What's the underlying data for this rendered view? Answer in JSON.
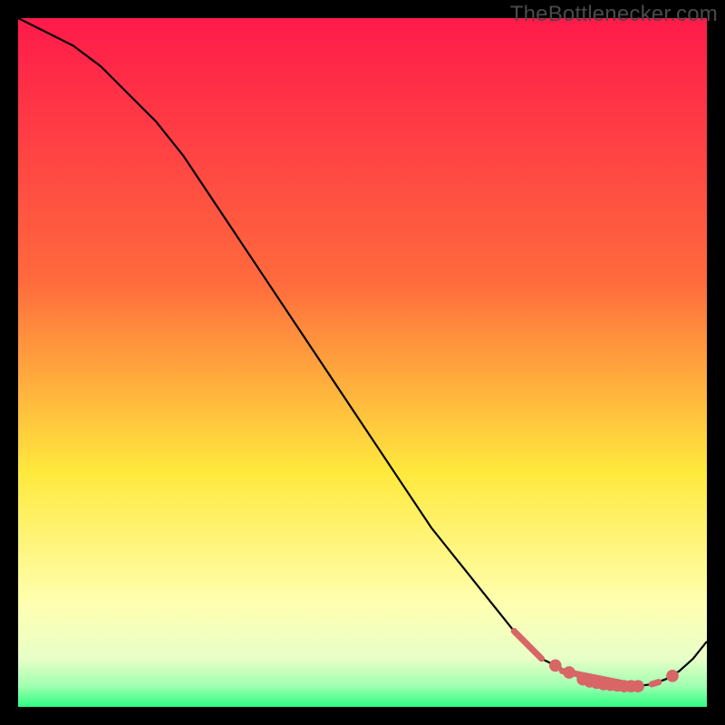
{
  "watermark": "TheBottlenecker.com",
  "colors": {
    "gradient_top": "#ff1a4a",
    "gradient_mid_orange": "#ff9e3d",
    "gradient_yellow": "#ffe93d",
    "gradient_pale_yellow": "#ffffb0",
    "gradient_mint": "#9fffb0",
    "gradient_green": "#2dff82",
    "curve_stroke": "#000000",
    "segment_color": "#d86666",
    "dot_color": "#d86666",
    "frame_bg": "#000000"
  },
  "chart_data": {
    "type": "line",
    "title": "",
    "xlabel": "",
    "ylabel": "",
    "xlim": [
      0,
      100
    ],
    "ylim": [
      0,
      100
    ],
    "curve": {
      "x": [
        0,
        4,
        8,
        12,
        16,
        20,
        24,
        28,
        32,
        36,
        40,
        44,
        48,
        52,
        56,
        60,
        64,
        68,
        72,
        76,
        78,
        80,
        82,
        84,
        86,
        88,
        90,
        92,
        94,
        96,
        98,
        100
      ],
      "y": [
        100,
        98,
        96,
        93,
        89,
        85,
        80,
        74,
        68,
        62,
        56,
        50,
        44,
        38,
        32,
        26,
        21,
        16,
        11,
        7,
        6,
        5,
        4,
        3.5,
        3.2,
        3.0,
        3.0,
        3.3,
        4.0,
        5.2,
        7.0,
        9.5
      ]
    },
    "highlight_segments": [
      {
        "x0": 72,
        "y0": 11,
        "x1": 76,
        "y1": 7
      },
      {
        "x0": 79,
        "y0": 5.2,
        "x1": 90,
        "y1": 3.0
      },
      {
        "x0": 92,
        "y0": 3.3,
        "x1": 93,
        "y1": 3.6
      }
    ],
    "dots": [
      {
        "x": 78,
        "y": 6
      },
      {
        "x": 80,
        "y": 5
      },
      {
        "x": 82,
        "y": 4
      },
      {
        "x": 83,
        "y": 3.7
      },
      {
        "x": 84,
        "y": 3.5
      },
      {
        "x": 85,
        "y": 3.3
      },
      {
        "x": 86,
        "y": 3.2
      },
      {
        "x": 87,
        "y": 3.1
      },
      {
        "x": 88,
        "y": 3.0
      },
      {
        "x": 89,
        "y": 3.0
      },
      {
        "x": 90,
        "y": 3.0
      },
      {
        "x": 95,
        "y": 4.5
      }
    ]
  }
}
